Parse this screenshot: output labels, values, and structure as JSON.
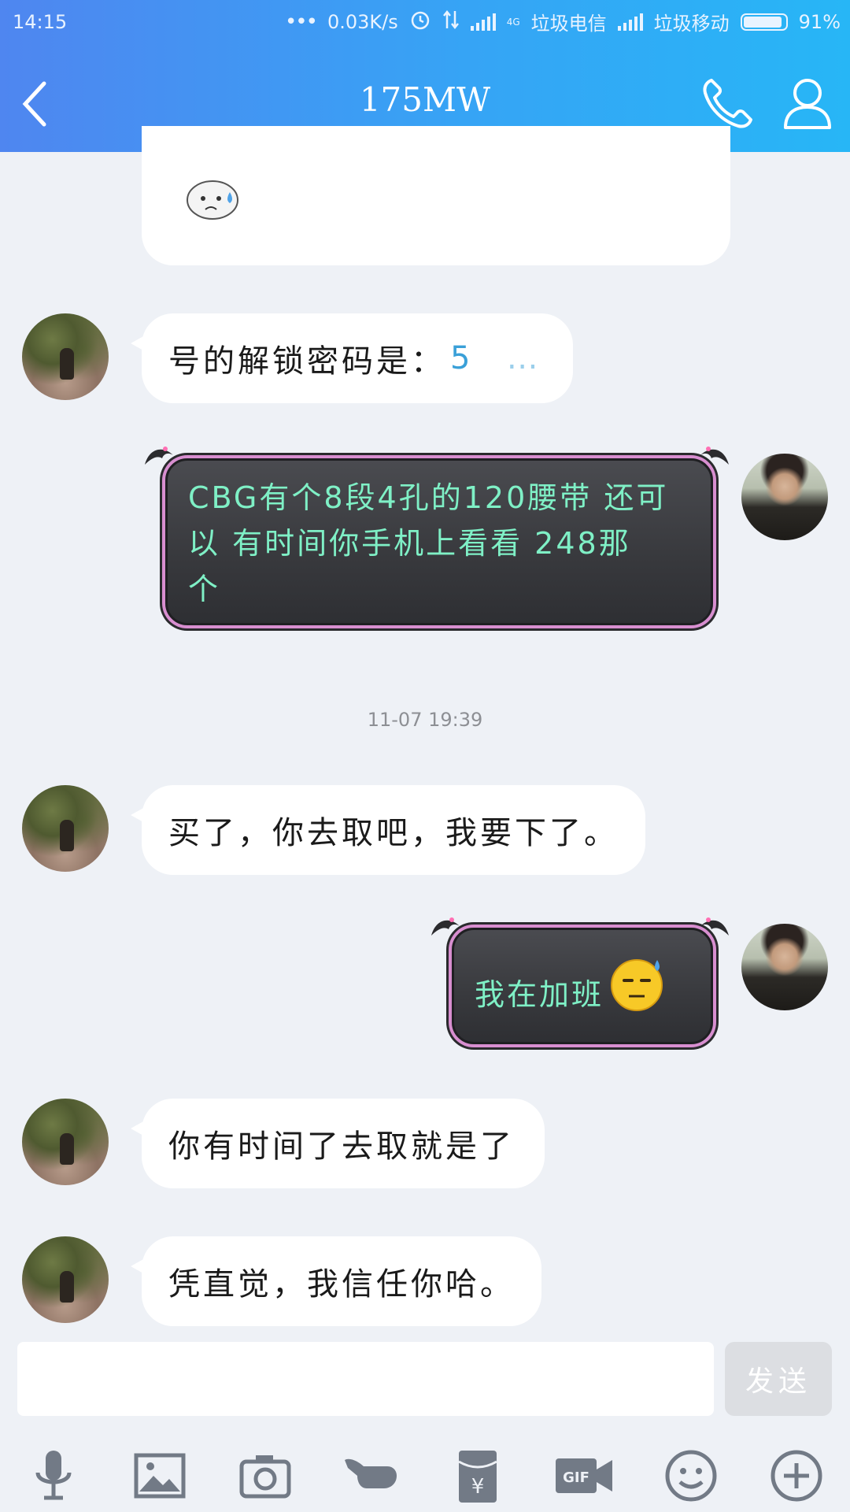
{
  "status_bar": {
    "time": "14:15",
    "net_speed": "0.03K/s",
    "carrier1": "垃圾电信",
    "carrier2": "垃圾移动",
    "battery": "91%",
    "net_type": "4G"
  },
  "header": {
    "title": "175MW"
  },
  "messages": [
    {
      "side": "left",
      "type": "sticker-card"
    },
    {
      "side": "left",
      "type": "text",
      "text": "号的解锁密码是："
    },
    {
      "side": "right",
      "type": "fancy",
      "lines": [
        "CBG有个8段4孔的120腰带  还可",
        "以  有时间你手机上看看  248那",
        "个"
      ]
    },
    {
      "type": "timestamp",
      "text": "11-07 19:39"
    },
    {
      "side": "left",
      "type": "text",
      "text": "买了，你去取吧，我要下了。"
    },
    {
      "side": "right",
      "type": "fancy",
      "text": "我在加班"
    },
    {
      "side": "left",
      "type": "text",
      "text": "你有时间了去取就是了"
    },
    {
      "side": "left",
      "type": "text",
      "text": "凭直觉，我信任你哈。"
    }
  ],
  "input": {
    "placeholder": "",
    "send_label": "发送"
  },
  "toolbar": {
    "icons": [
      "microphone-icon",
      "image-icon",
      "camera-icon",
      "poke-icon",
      "red-packet-icon",
      "gif-icon",
      "emoji-icon",
      "plus-icon"
    ]
  },
  "colors": {
    "header_start": "#4f86f0",
    "header_end": "#27b6f6",
    "fancy_text": "#7ff0c6",
    "background": "#eef1f6"
  }
}
